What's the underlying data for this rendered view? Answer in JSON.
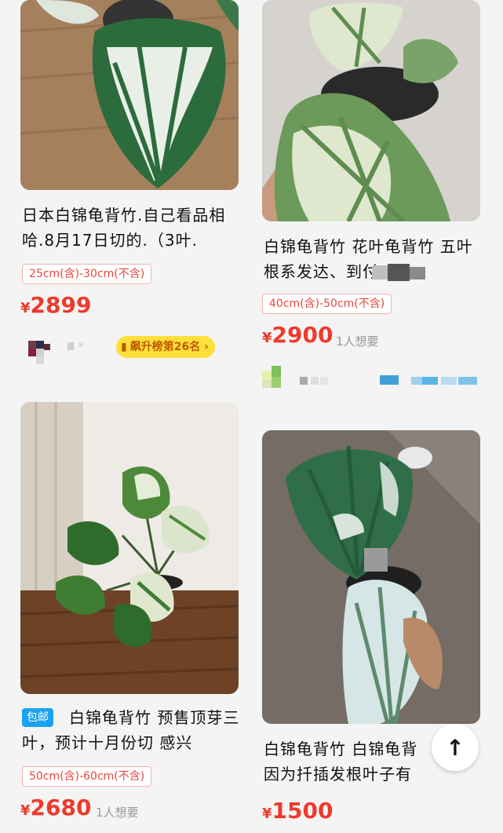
{
  "items": [
    {
      "title": "日本白锦龟背竹.自己看品相哈.8月17日切的.（3叶.",
      "spec": "25cm(含)-30cm(不含)",
      "price_symbol": "¥",
      "price": "2899",
      "rank_label": "飙升榜第26名 ›"
    },
    {
      "title": "白锦龟背竹 花叶龟背竹 五叶 根系发达、到付！",
      "spec": "40cm(含)-50cm(不含)",
      "price_symbol": "¥",
      "price": "2900",
      "wants": "1人想要"
    },
    {
      "badge": "包邮",
      "title": "白锦龟背竹 预售顶芽三叶，预计十月份切 感兴",
      "spec": "50cm(含)-60cm(不含)",
      "price_symbol": "¥",
      "price": "2680",
      "wants": "1人想要"
    },
    {
      "title": "白锦龟背竹 白锦龟背 因为扦插发根叶子有些",
      "price_symbol": "¥",
      "price": "1500"
    }
  ],
  "back_to_top_icon": "arrow-up-icon",
  "colors": {
    "price": "#ee3a2c",
    "rank_bg": "#ffdf3a",
    "badge": "#1aa3f0"
  }
}
